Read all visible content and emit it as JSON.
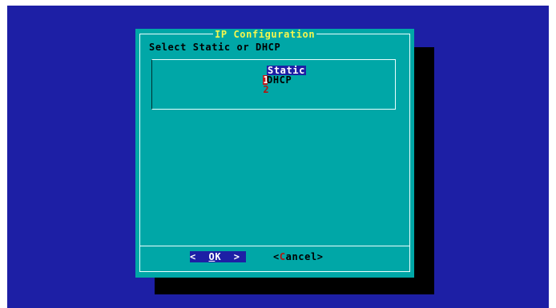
{
  "dialog": {
    "title": "IP Configuration",
    "prompt": "Select Static or DHCP",
    "items": [
      {
        "tag": "1",
        "label": "Static",
        "selected": true
      },
      {
        "tag": "2",
        "label": "DHCP",
        "selected": false
      }
    ],
    "buttons": {
      "ok": {
        "left": "<",
        "hot": "O",
        "rest": "K",
        "right": ">"
      },
      "cancel": {
        "left": "<",
        "hot": "C",
        "rest": "ancel",
        "right": ">"
      }
    }
  },
  "colors": {
    "screen_background": "#1d1fa5",
    "dialog_background": "#00a7a7",
    "title_text": "#f5f74e",
    "hotkey": "#b5140e",
    "selection": "#1d1fa5"
  }
}
